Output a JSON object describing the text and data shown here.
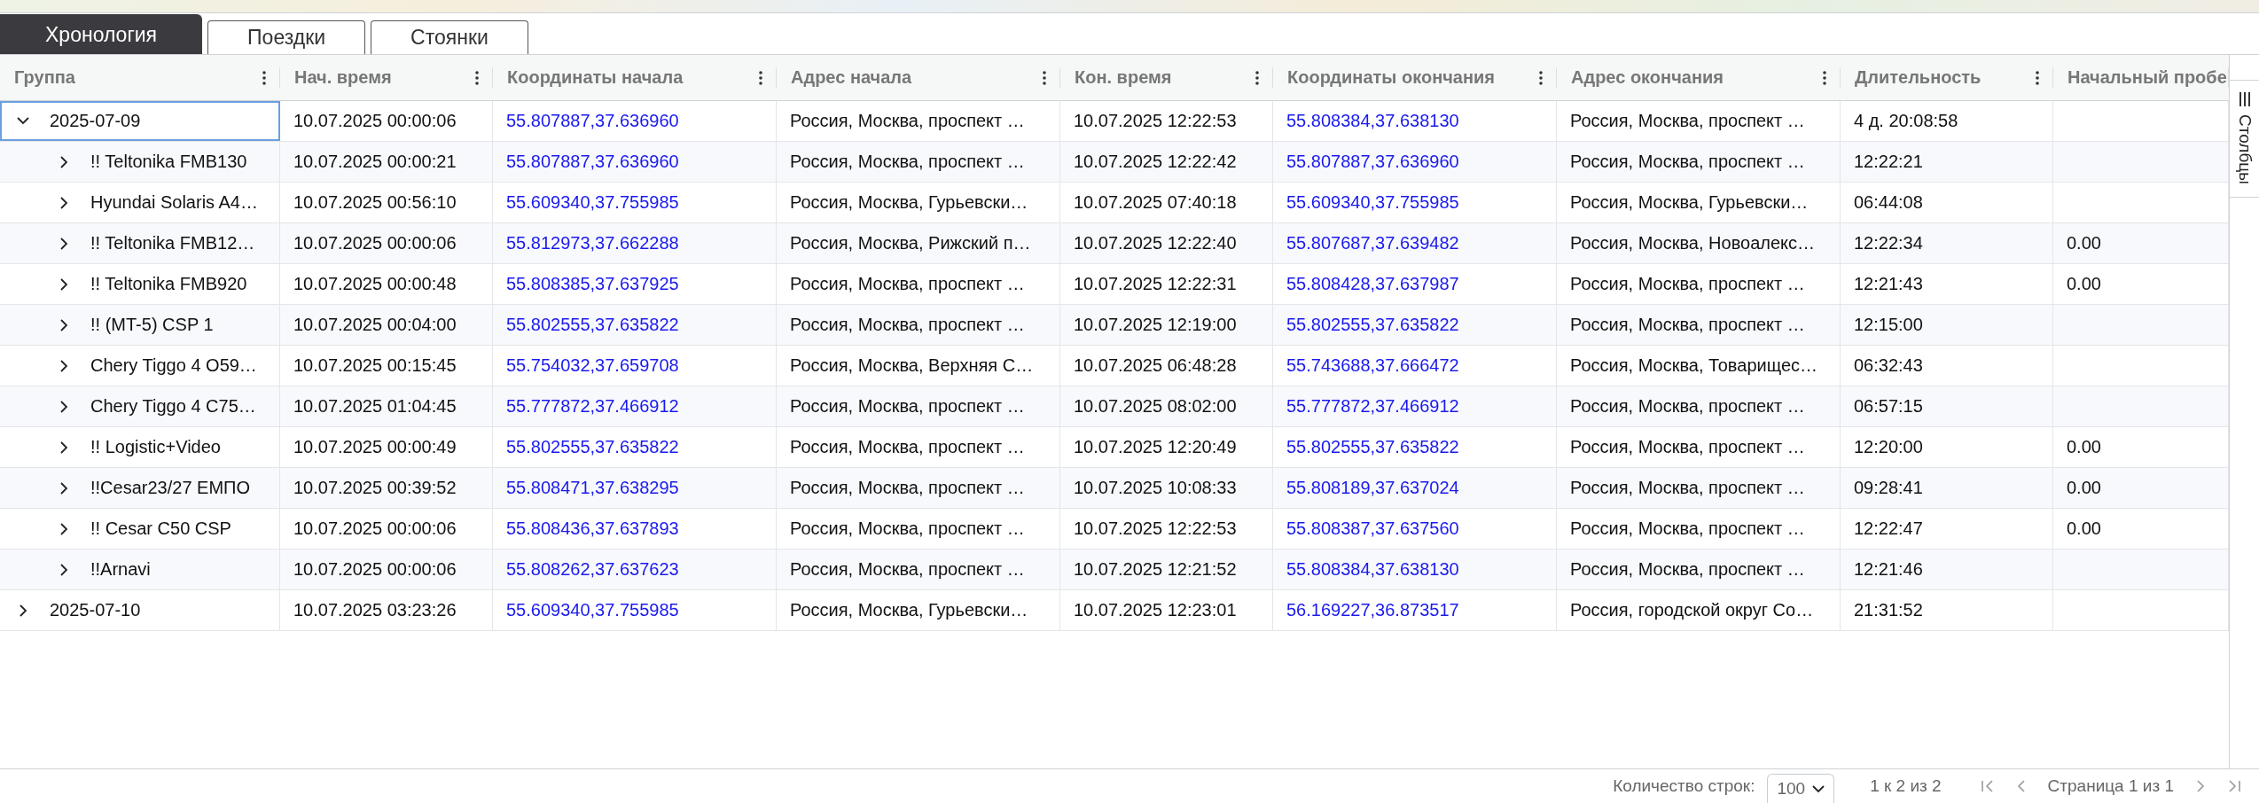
{
  "tabs": [
    {
      "label": "Хронология",
      "selected": true
    },
    {
      "label": "Поездки",
      "selected": false
    },
    {
      "label": "Стоянки",
      "selected": false
    }
  ],
  "table": {
    "columns": [
      {
        "label": "Группа",
        "kind": "tree",
        "menu": true
      },
      {
        "label": "Нач. время",
        "kind": "text",
        "menu": true
      },
      {
        "label": "Координаты начала",
        "kind": "link",
        "menu": true
      },
      {
        "label": "Адрес начала",
        "kind": "text",
        "menu": true
      },
      {
        "label": "Кон. время",
        "kind": "text",
        "menu": true
      },
      {
        "label": "Координаты окончания",
        "kind": "link",
        "menu": true
      },
      {
        "label": "Адрес окончания",
        "kind": "text",
        "menu": true
      },
      {
        "label": "Длительность",
        "kind": "text",
        "menu": true
      },
      {
        "label": "Начальный пробе",
        "kind": "text",
        "menu": false
      }
    ],
    "rows": [
      {
        "expanded": true,
        "selected": true,
        "cells": [
          "2025-07-09",
          "10.07.2025 00:00:06",
          "55.807887,37.636960",
          "Россия, Москва, проспект …",
          "10.07.2025 12:22:53",
          "55.808384,37.638130",
          "Россия, Москва, проспект …",
          "4 д. 20:08:58"
        ],
        "children": [
          {
            "expanded": false,
            "selected": false,
            "cells": [
              "!! Teltonika FMB130",
              "10.07.2025 00:00:21",
              "55.807887,37.636960",
              "Россия, Москва, проспект …",
              "10.07.2025 12:22:42",
              "55.807887,37.636960",
              "Россия, Москва, проспект …",
              "12:22:21"
            ]
          },
          {
            "expanded": false,
            "selected": false,
            "cells": [
              "Hyundai Solaris A4…",
              "10.07.2025 00:56:10",
              "55.609340,37.755985",
              "Россия, Москва, Гурьевски…",
              "10.07.2025 07:40:18",
              "55.609340,37.755985",
              "Россия, Москва, Гурьевски…",
              "06:44:08"
            ]
          },
          {
            "expanded": false,
            "selected": false,
            "cells": [
              "!! Teltonika FMB12…",
              "10.07.2025 00:00:06",
              "55.812973,37.662288",
              "Россия, Москва, Рижский п…",
              "10.07.2025 12:22:40",
              "55.807687,37.639482",
              "Россия, Москва, Новоалекс…",
              "12:22:34",
              "0.00"
            ]
          },
          {
            "expanded": false,
            "selected": false,
            "cells": [
              "!! Teltonika FMB920",
              "10.07.2025 00:00:48",
              "55.808385,37.637925",
              "Россия, Москва, проспект …",
              "10.07.2025 12:22:31",
              "55.808428,37.637987",
              "Россия, Москва, проспект …",
              "12:21:43",
              "0.00"
            ]
          },
          {
            "expanded": false,
            "selected": false,
            "cells": [
              "!! (MT-5) CSP 1",
              "10.07.2025 00:04:00",
              "55.802555,37.635822",
              "Россия, Москва, проспект …",
              "10.07.2025 12:19:00",
              "55.802555,37.635822",
              "Россия, Москва, проспект …",
              "12:15:00"
            ]
          },
          {
            "expanded": false,
            "selected": false,
            "cells": [
              "Chery Tiggo 4 O59…",
              "10.07.2025 00:15:45",
              "55.754032,37.659708",
              "Россия, Москва, Верхняя С…",
              "10.07.2025 06:48:28",
              "55.743688,37.666472",
              "Россия, Москва, Товарищес…",
              "06:32:43"
            ]
          },
          {
            "expanded": false,
            "selected": false,
            "cells": [
              "Chery Tiggo 4 C75…",
              "10.07.2025 01:04:45",
              "55.777872,37.466912",
              "Россия, Москва, проспект …",
              "10.07.2025 08:02:00",
              "55.777872,37.466912",
              "Россия, Москва, проспект …",
              "06:57:15"
            ]
          },
          {
            "expanded": false,
            "selected": false,
            "cells": [
              "!! Logistic+Video",
              "10.07.2025 00:00:49",
              "55.802555,37.635822",
              "Россия, Москва, проспект …",
              "10.07.2025 12:20:49",
              "55.802555,37.635822",
              "Россия, Москва, проспект …",
              "12:20:00",
              "0.00"
            ]
          },
          {
            "expanded": false,
            "selected": false,
            "cells": [
              "!!Cesar23/27 ЕМПО",
              "10.07.2025 00:39:52",
              "55.808471,37.638295",
              "Россия, Москва, проспект …",
              "10.07.2025 10:08:33",
              "55.808189,37.637024",
              "Россия, Москва, проспект …",
              "09:28:41",
              "0.00"
            ]
          },
          {
            "expanded": false,
            "selected": false,
            "cells": [
              "!! Cesar C50 CSP",
              "10.07.2025 00:00:06",
              "55.808436,37.637893",
              "Россия, Москва, проспект …",
              "10.07.2025 12:22:53",
              "55.808387,37.637560",
              "Россия, Москва, проспект …",
              "12:22:47",
              "0.00"
            ]
          },
          {
            "expanded": false,
            "selected": false,
            "cells": [
              "!!Arnavi",
              "10.07.2025 00:00:06",
              "55.808262,37.637623",
              "Россия, Москва, проспект …",
              "10.07.2025 12:21:52",
              "55.808384,37.638130",
              "Россия, Москва, проспект …",
              "12:21:46"
            ]
          }
        ]
      },
      {
        "expanded": false,
        "selected": false,
        "cells": [
          "2025-07-10",
          "10.07.2025 03:23:26",
          "55.609340,37.755985",
          "Россия, Москва, Гурьевски…",
          "10.07.2025 12:23:01",
          "56.169227,36.873517",
          "Россия, городской округ Со…",
          "21:31:52"
        ]
      }
    ]
  },
  "side_panel": {
    "label": "Столбцы"
  },
  "footer": {
    "page_size_label": "Количество строк:",
    "page_size": "100",
    "range": "1 к 2 из 2",
    "page": "Страница 1 из 1"
  }
}
